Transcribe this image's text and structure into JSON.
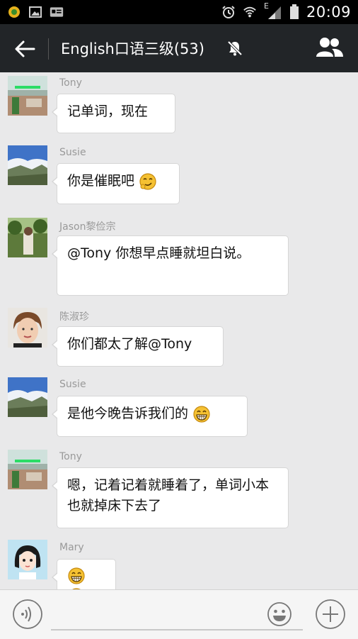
{
  "status_bar": {
    "time": "20:09",
    "network_label": "E"
  },
  "header": {
    "title": "English口语三级(53)"
  },
  "messages": [
    {
      "sender": "Tony",
      "text": "记单词，现在"
    },
    {
      "sender": "Susie",
      "text": "你是催眠吧"
    },
    {
      "sender": "Jason黎俭宗",
      "text": "@Tony 你想早点睡就坦白说。"
    },
    {
      "sender": "陈淑珍",
      "text": "你们都太了解@Tony"
    },
    {
      "sender": "Susie",
      "text": "是他今晚告诉我们的"
    },
    {
      "sender": "Tony",
      "text": "嗯，记着记着就睡着了，单词小本也就掉床下去了"
    },
    {
      "sender": "Mary",
      "text": ""
    }
  ],
  "colors": {
    "status_bar": "#000000",
    "title_bar": "#222528",
    "chat_background": "#e9e9ea",
    "bubble": "#ffffff",
    "bottom_bar": "#f5f5f5"
  },
  "icons": [
    "back-arrow-icon",
    "mute-icon",
    "members-icon",
    "voice-icon",
    "emoji-icon",
    "plus-icon"
  ]
}
